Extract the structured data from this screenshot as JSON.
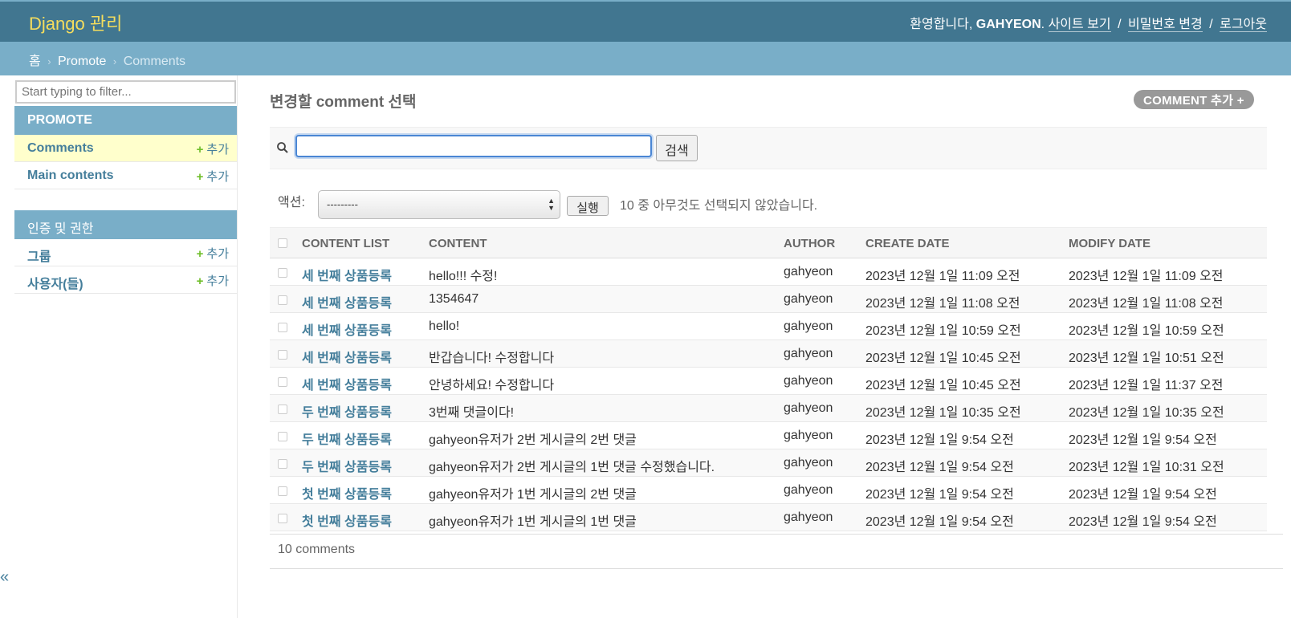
{
  "header": {
    "branding": "Django 관리",
    "welcome": "환영합니다,",
    "username": "GAHYEON",
    "period": ".",
    "links": [
      "사이트 보기",
      "비밀번호 변경",
      "로그아웃"
    ]
  },
  "breadcrumbs": {
    "home": "홈",
    "app": "Promote",
    "current": "Comments",
    "sep": "›"
  },
  "sidebar": {
    "filter_placeholder": "Start typing to filter...",
    "collapse": "«",
    "modules": [
      {
        "caption": "PROMOTE",
        "items": [
          {
            "name": "Comments",
            "add": "추가"
          },
          {
            "name": "Main contents",
            "add": "추가"
          }
        ]
      },
      {
        "caption": "인증 및 권한",
        "items": [
          {
            "name": "그룹",
            "add": "추가"
          },
          {
            "name": "사용자(들)",
            "add": "추가"
          }
        ]
      }
    ],
    "plus": "+"
  },
  "content": {
    "title": "변경할 comment 선택",
    "add_button": "COMMENT 추가 +",
    "search_button": "검색",
    "action_label": "액션:",
    "action_selected": "---------",
    "go_button": "실행",
    "action_counter": "10 중 아무것도 선택되지 않았습니다.",
    "columns": [
      "CONTENT LIST",
      "CONTENT",
      "AUTHOR",
      "CREATE DATE",
      "MODIFY DATE"
    ],
    "rows": [
      [
        "세 번째 상품등록",
        "hello!!! 수정!",
        "gahyeon",
        "2023년 12월 1일 11:09 오전",
        "2023년 12월 1일 11:09 오전"
      ],
      [
        "세 번째 상품등록",
        "1354647",
        "gahyeon",
        "2023년 12월 1일 11:08 오전",
        "2023년 12월 1일 11:08 오전"
      ],
      [
        "세 번째 상품등록",
        "hello!",
        "gahyeon",
        "2023년 12월 1일 10:59 오전",
        "2023년 12월 1일 10:59 오전"
      ],
      [
        "세 번째 상품등록",
        "반갑습니다! 수정합니다",
        "gahyeon",
        "2023년 12월 1일 10:45 오전",
        "2023년 12월 1일 10:51 오전"
      ],
      [
        "세 번째 상품등록",
        "안녕하세요! 수정합니다",
        "gahyeon",
        "2023년 12월 1일 10:45 오전",
        "2023년 12월 1일 11:37 오전"
      ],
      [
        "두 번째 상품등록",
        "3번째 댓글이다!",
        "gahyeon",
        "2023년 12월 1일 10:35 오전",
        "2023년 12월 1일 10:35 오전"
      ],
      [
        "두 번째 상품등록",
        "gahyeon유저가 2번 게시글의 2번 댓글",
        "gahyeon",
        "2023년 12월 1일 9:54 오전",
        "2023년 12월 1일 9:54 오전"
      ],
      [
        "두 번째 상품등록",
        "gahyeon유저가 2번 게시글의 1번 댓글 수정했습니다.",
        "gahyeon",
        "2023년 12월 1일 9:54 오전",
        "2023년 12월 1일 10:31 오전"
      ],
      [
        "첫 번째 상품등록",
        "gahyeon유저가 1번 게시글의 2번 댓글",
        "gahyeon",
        "2023년 12월 1일 9:54 오전",
        "2023년 12월 1일 9:54 오전"
      ],
      [
        "첫 번째 상품등록",
        "gahyeon유저가 1번 게시글의 1번 댓글",
        "gahyeon",
        "2023년 12월 1일 9:54 오전",
        "2023년 12월 1일 9:54 오전"
      ]
    ],
    "paginator": "10 comments"
  },
  "colors": {
    "header": "#417690",
    "breadcrumbs": "#79aec8",
    "branding": "#f5dd5d",
    "link": "#447e9b",
    "add_plus": "#70bf2b"
  }
}
